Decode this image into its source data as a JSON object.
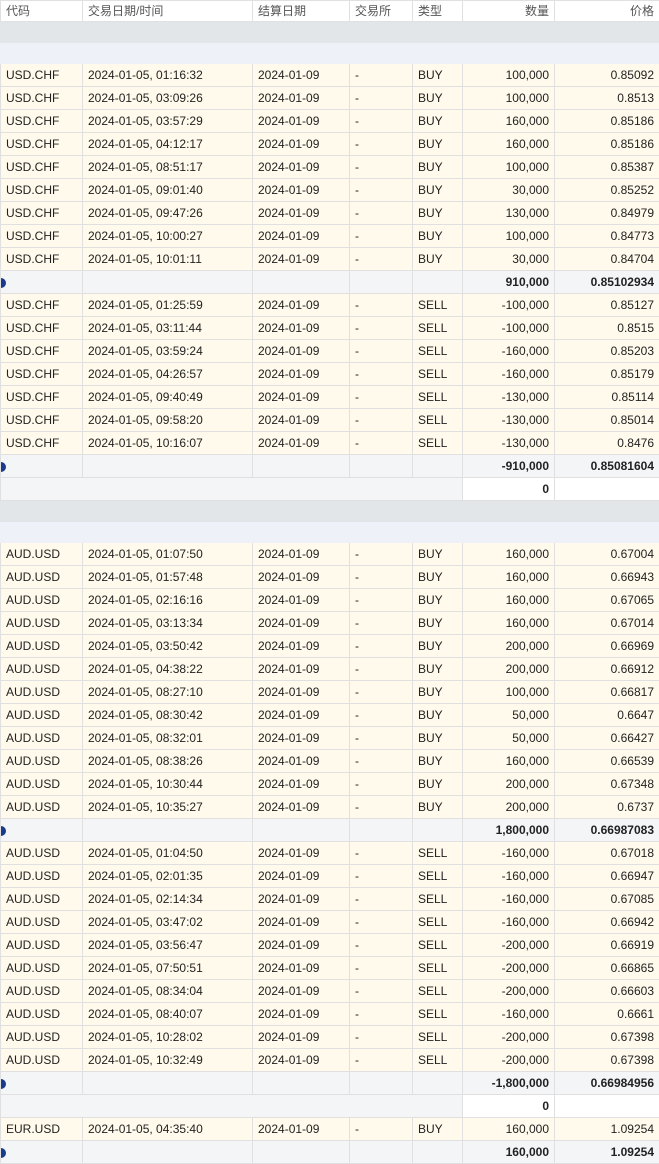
{
  "headers": [
    "代码",
    "交易日期/时间",
    "结算日期",
    "交易所",
    "类型",
    "数量",
    "价格"
  ],
  "groups": [
    {
      "sections": [
        {
          "trades": [
            [
              "USD.CHF",
              "2024-01-05, 01:16:32",
              "2024-01-09",
              "-",
              "BUY",
              "100,000",
              "0.85092"
            ],
            [
              "USD.CHF",
              "2024-01-05, 03:09:26",
              "2024-01-09",
              "-",
              "BUY",
              "100,000",
              "0.8513"
            ],
            [
              "USD.CHF",
              "2024-01-05, 03:57:29",
              "2024-01-09",
              "-",
              "BUY",
              "160,000",
              "0.85186"
            ],
            [
              "USD.CHF",
              "2024-01-05, 04:12:17",
              "2024-01-09",
              "-",
              "BUY",
              "160,000",
              "0.85186"
            ],
            [
              "USD.CHF",
              "2024-01-05, 08:51:17",
              "2024-01-09",
              "-",
              "BUY",
              "100,000",
              "0.85387"
            ],
            [
              "USD.CHF",
              "2024-01-05, 09:01:40",
              "2024-01-09",
              "-",
              "BUY",
              "30,000",
              "0.85252"
            ],
            [
              "USD.CHF",
              "2024-01-05, 09:47:26",
              "2024-01-09",
              "-",
              "BUY",
              "130,000",
              "0.84979"
            ],
            [
              "USD.CHF",
              "2024-01-05, 10:00:27",
              "2024-01-09",
              "-",
              "BUY",
              "100,000",
              "0.84773"
            ],
            [
              "USD.CHF",
              "2024-01-05, 10:01:11",
              "2024-01-09",
              "-",
              "BUY",
              "30,000",
              "0.84704"
            ]
          ],
          "subtotal_qty": "910,000",
          "subtotal_price": "0.85102934"
        },
        {
          "trades": [
            [
              "USD.CHF",
              "2024-01-05, 01:25:59",
              "2024-01-09",
              "-",
              "SELL",
              "-100,000",
              "0.85127"
            ],
            [
              "USD.CHF",
              "2024-01-05, 03:11:44",
              "2024-01-09",
              "-",
              "SELL",
              "-100,000",
              "0.8515"
            ],
            [
              "USD.CHF",
              "2024-01-05, 03:59:24",
              "2024-01-09",
              "-",
              "SELL",
              "-160,000",
              "0.85203"
            ],
            [
              "USD.CHF",
              "2024-01-05, 04:26:57",
              "2024-01-09",
              "-",
              "SELL",
              "-160,000",
              "0.85179"
            ],
            [
              "USD.CHF",
              "2024-01-05, 09:40:49",
              "2024-01-09",
              "-",
              "SELL",
              "-130,000",
              "0.85114"
            ],
            [
              "USD.CHF",
              "2024-01-05, 09:58:20",
              "2024-01-09",
              "-",
              "SELL",
              "-130,000",
              "0.85014"
            ],
            [
              "USD.CHF",
              "2024-01-05, 10:16:07",
              "2024-01-09",
              "-",
              "SELL",
              "-130,000",
              "0.8476"
            ]
          ],
          "subtotal_qty": "-910,000",
          "subtotal_price": "0.85081604"
        }
      ],
      "net_qty": "0"
    },
    {
      "sections": [
        {
          "trades": [
            [
              "AUD.USD",
              "2024-01-05, 01:07:50",
              "2024-01-09",
              "-",
              "BUY",
              "160,000",
              "0.67004"
            ],
            [
              "AUD.USD",
              "2024-01-05, 01:57:48",
              "2024-01-09",
              "-",
              "BUY",
              "160,000",
              "0.66943"
            ],
            [
              "AUD.USD",
              "2024-01-05, 02:16:16",
              "2024-01-09",
              "-",
              "BUY",
              "160,000",
              "0.67065"
            ],
            [
              "AUD.USD",
              "2024-01-05, 03:13:34",
              "2024-01-09",
              "-",
              "BUY",
              "160,000",
              "0.67014"
            ],
            [
              "AUD.USD",
              "2024-01-05, 03:50:42",
              "2024-01-09",
              "-",
              "BUY",
              "200,000",
              "0.66969"
            ],
            [
              "AUD.USD",
              "2024-01-05, 04:38:22",
              "2024-01-09",
              "-",
              "BUY",
              "200,000",
              "0.66912"
            ],
            [
              "AUD.USD",
              "2024-01-05, 08:27:10",
              "2024-01-09",
              "-",
              "BUY",
              "100,000",
              "0.66817"
            ],
            [
              "AUD.USD",
              "2024-01-05, 08:30:42",
              "2024-01-09",
              "-",
              "BUY",
              "50,000",
              "0.6647"
            ],
            [
              "AUD.USD",
              "2024-01-05, 08:32:01",
              "2024-01-09",
              "-",
              "BUY",
              "50,000",
              "0.66427"
            ],
            [
              "AUD.USD",
              "2024-01-05, 08:38:26",
              "2024-01-09",
              "-",
              "BUY",
              "160,000",
              "0.66539"
            ],
            [
              "AUD.USD",
              "2024-01-05, 10:30:44",
              "2024-01-09",
              "-",
              "BUY",
              "200,000",
              "0.67348"
            ],
            [
              "AUD.USD",
              "2024-01-05, 10:35:27",
              "2024-01-09",
              "-",
              "BUY",
              "200,000",
              "0.6737"
            ]
          ],
          "subtotal_qty": "1,800,000",
          "subtotal_price": "0.66987083"
        },
        {
          "trades": [
            [
              "AUD.USD",
              "2024-01-05, 01:04:50",
              "2024-01-09",
              "-",
              "SELL",
              "-160,000",
              "0.67018"
            ],
            [
              "AUD.USD",
              "2024-01-05, 02:01:35",
              "2024-01-09",
              "-",
              "SELL",
              "-160,000",
              "0.66947"
            ],
            [
              "AUD.USD",
              "2024-01-05, 02:14:34",
              "2024-01-09",
              "-",
              "SELL",
              "-160,000",
              "0.67085"
            ],
            [
              "AUD.USD",
              "2024-01-05, 03:47:02",
              "2024-01-09",
              "-",
              "SELL",
              "-160,000",
              "0.66942"
            ],
            [
              "AUD.USD",
              "2024-01-05, 03:56:47",
              "2024-01-09",
              "-",
              "SELL",
              "-200,000",
              "0.66919"
            ],
            [
              "AUD.USD",
              "2024-01-05, 07:50:51",
              "2024-01-09",
              "-",
              "SELL",
              "-200,000",
              "0.66865"
            ],
            [
              "AUD.USD",
              "2024-01-05, 08:34:04",
              "2024-01-09",
              "-",
              "SELL",
              "-200,000",
              "0.66603"
            ],
            [
              "AUD.USD",
              "2024-01-05, 08:40:07",
              "2024-01-09",
              "-",
              "SELL",
              "-160,000",
              "0.6661"
            ],
            [
              "AUD.USD",
              "2024-01-05, 10:28:02",
              "2024-01-09",
              "-",
              "SELL",
              "-200,000",
              "0.67398"
            ],
            [
              "AUD.USD",
              "2024-01-05, 10:32:49",
              "2024-01-09",
              "-",
              "SELL",
              "-200,000",
              "0.67398"
            ]
          ],
          "subtotal_qty": "-1,800,000",
          "subtotal_price": "0.66984956"
        }
      ],
      "net_qty": "0"
    },
    {
      "sections": [
        {
          "trades": [
            [
              "EUR.USD",
              "2024-01-05, 04:35:40",
              "2024-01-09",
              "-",
              "BUY",
              "160,000",
              "1.09254"
            ]
          ],
          "subtotal_qty": "160,000",
          "subtotal_price": "1.09254"
        }
      ]
    }
  ]
}
